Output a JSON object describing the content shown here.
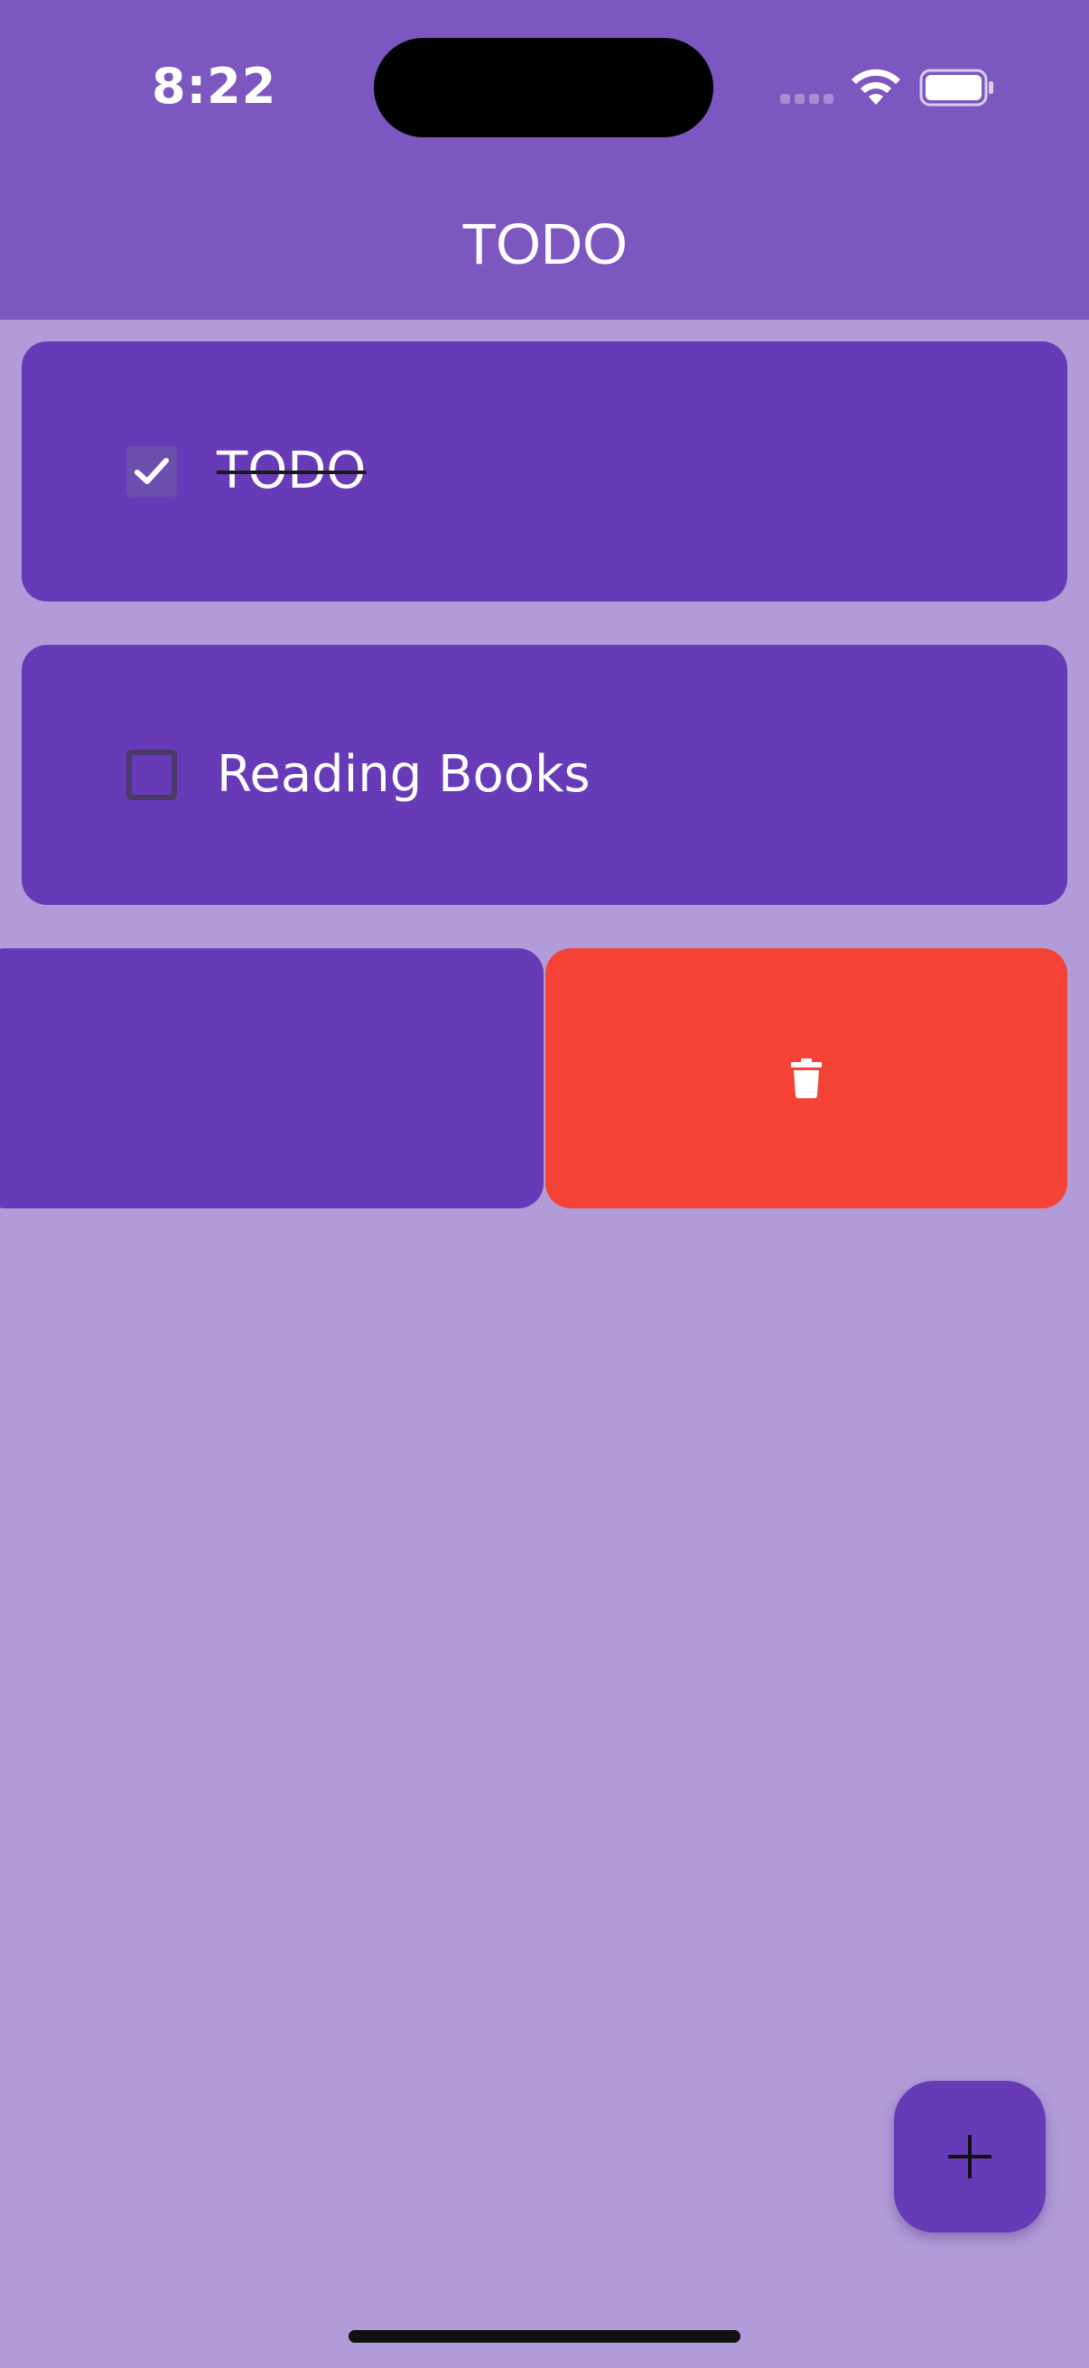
{
  "status_bar": {
    "time": "8:22"
  },
  "app_bar": {
    "title": "TODO",
    "color": "#7C57C0"
  },
  "todos": [
    {
      "label": "TODO",
      "done": true
    },
    {
      "label": "Reading Books",
      "done": false
    },
    {
      "label": "",
      "done": false,
      "swiped": true
    }
  ],
  "swipe_action": {
    "icon": "trash-icon",
    "color": "#F44336"
  },
  "fab": {
    "icon": "plus-icon"
  },
  "colors": {
    "background": "#B19CD9",
    "card": "#673AB7",
    "accent": "#7C57C0",
    "danger": "#F44336"
  },
  "battery": {
    "level": 1.0
  }
}
